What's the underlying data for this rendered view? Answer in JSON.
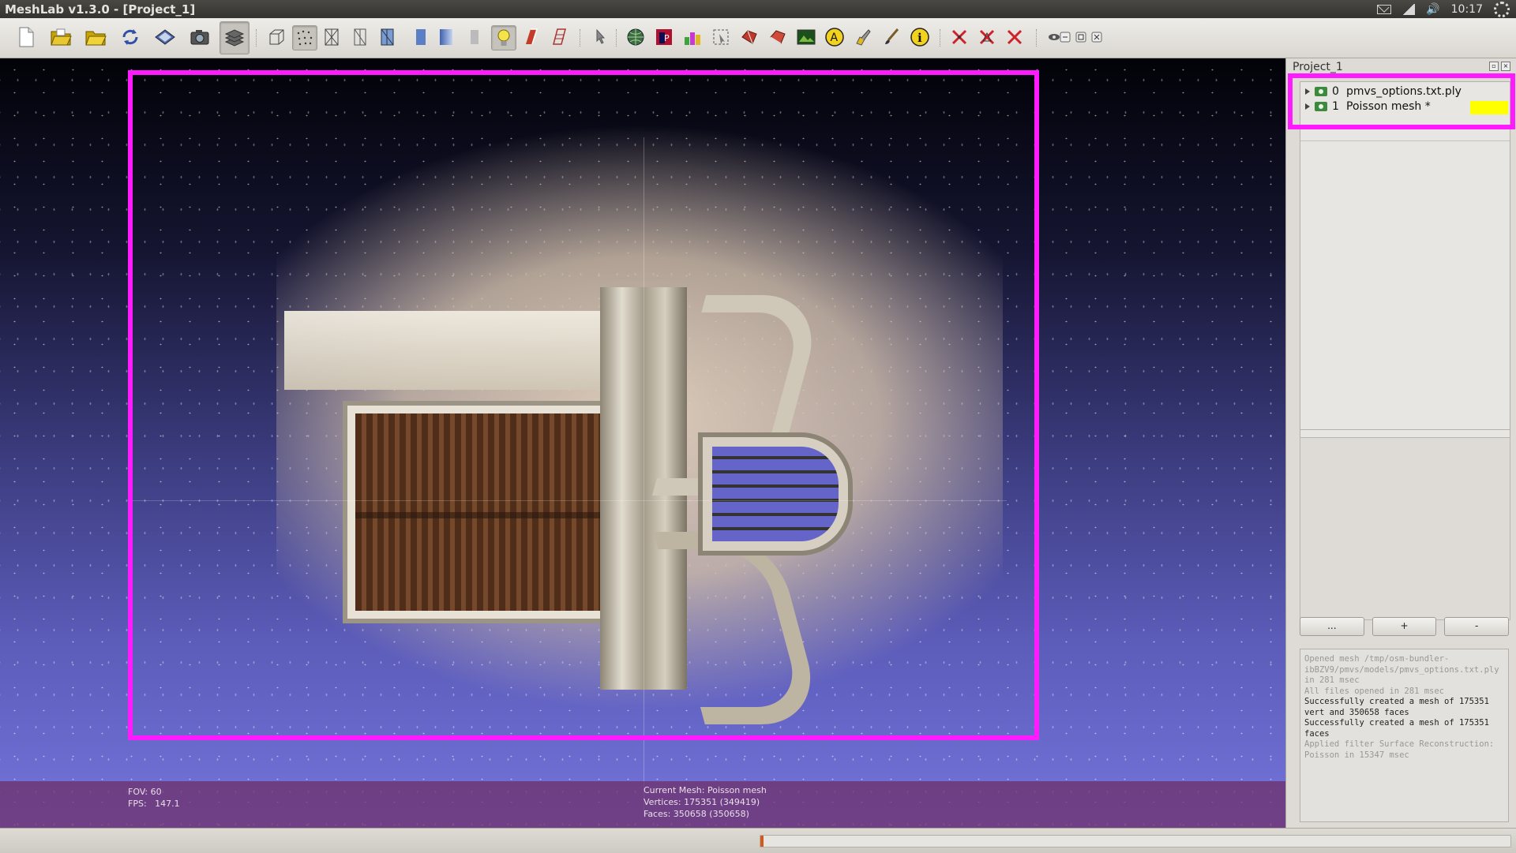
{
  "window": {
    "title": "MeshLab v1.3.0 - [Project_1]"
  },
  "system_tray": {
    "clock": "10:17",
    "icons": [
      "mail-icon",
      "network-icon",
      "volume-icon",
      "settings-gear-icon"
    ]
  },
  "toolbar": {
    "buttons": [
      {
        "name": "new-project-icon"
      },
      {
        "name": "open-project-icon"
      },
      {
        "name": "open-mesh-icon"
      },
      {
        "name": "reload-icon"
      },
      {
        "name": "save-snapshot-disk-icon"
      },
      {
        "name": "snapshot-camera-icon"
      },
      {
        "name": "layers-icon",
        "pressed": true
      },
      {
        "name": "render-bbox-icon"
      },
      {
        "name": "render-points-icon",
        "pressed": true
      },
      {
        "name": "render-wireframe-icon"
      },
      {
        "name": "render-hiddenlines-icon"
      },
      {
        "name": "render-flatlines-icon"
      },
      {
        "name": "render-flat-icon"
      },
      {
        "name": "render-smooth-icon"
      },
      {
        "name": "render-texture-icon"
      },
      {
        "name": "light-on-icon",
        "pressed": true
      },
      {
        "name": "double-side-light-icon"
      },
      {
        "name": "fancy-light-icon"
      },
      {
        "name": "pick-icon"
      },
      {
        "name": "decorate-globe-icon"
      },
      {
        "name": "decorate-color-icon"
      },
      {
        "name": "measure-tool-icon"
      },
      {
        "name": "select-vertices-icon"
      },
      {
        "name": "select-faces-icon"
      },
      {
        "name": "select-connected-icon"
      },
      {
        "name": "raster-icon"
      },
      {
        "name": "annotation-a-icon"
      },
      {
        "name": "paint-icon"
      },
      {
        "name": "brush-icon"
      },
      {
        "name": "info-icon"
      },
      {
        "name": "delete-selected-vertices-icon"
      },
      {
        "name": "delete-selected-faces-icon"
      },
      {
        "name": "delete-selection-icon"
      },
      {
        "name": "eye-view-icon"
      },
      {
        "name": "window-minimize-icon"
      },
      {
        "name": "window-restore-icon"
      },
      {
        "name": "window-close-icon"
      }
    ]
  },
  "viewport": {
    "fov_line": "FOV: 60",
    "fps_line": "FPS:   147.1",
    "current_mesh_line": "Current Mesh: Poisson mesh",
    "vertices_line": "Vertices: 175351 (349419)",
    "faces_line": "Faces: 350658 (350658)"
  },
  "layer_panel": {
    "title": "Project_1",
    "layers": [
      {
        "index": "0",
        "name": "pmvs_options.txt.ply"
      },
      {
        "index": "1",
        "name": "Poisson mesh *"
      }
    ],
    "buttons": [
      "...",
      "+",
      "-"
    ]
  },
  "log": [
    {
      "text": "Opened mesh /tmp/osm-bundler-ibBZV9/pmvs/models/pmvs_options.txt.ply in 281 msec",
      "style": "dim"
    },
    {
      "text": "All files opened in 281 msec",
      "style": "dim"
    },
    {
      "text": "Successfully created a mesh of 175351 vert and 350658 faces",
      "style": "strong"
    },
    {
      "text": "Successfully created a mesh of 175351 faces",
      "style": "strong"
    },
    {
      "text": "Applied filter Surface Reconstruction: Poisson in 15347 msec",
      "style": "dim"
    }
  ],
  "status": {
    "progress_fraction": 0.004
  },
  "colors": {
    "highlight": "#ff1aff",
    "layer_flag": "#ffff00",
    "progress": "#d35a18"
  }
}
